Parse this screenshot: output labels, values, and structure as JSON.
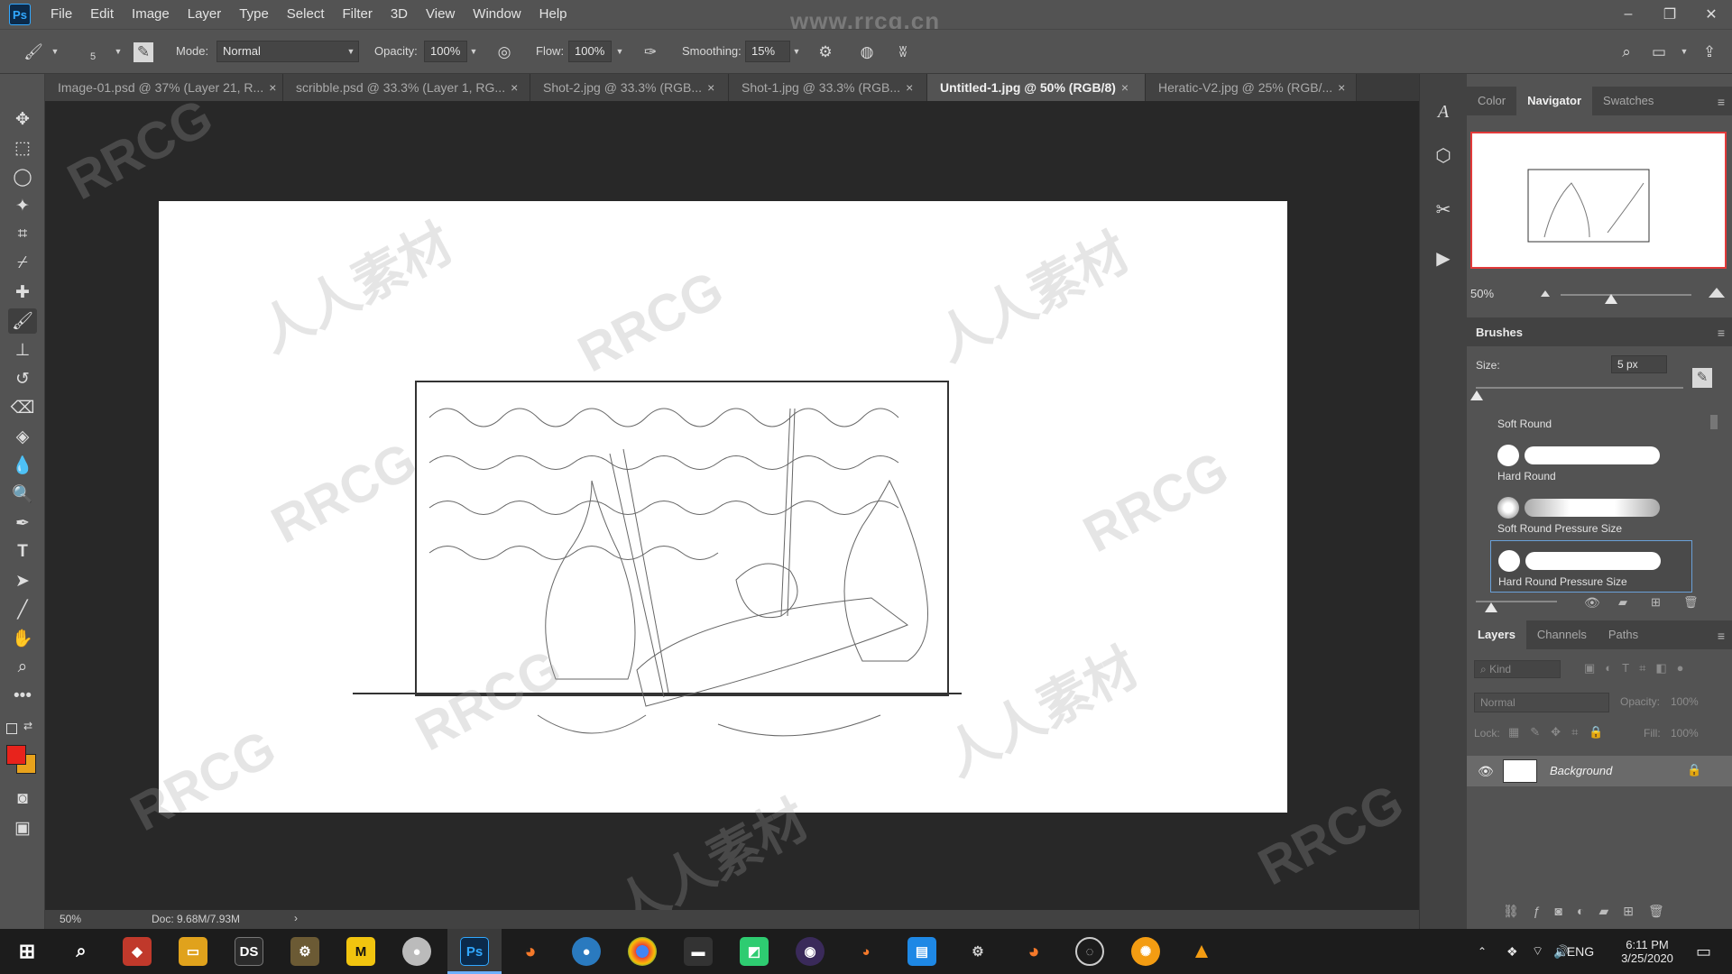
{
  "app": {
    "logo": "Ps",
    "menu": [
      "File",
      "Edit",
      "Image",
      "Layer",
      "Type",
      "Select",
      "Filter",
      "3D",
      "View",
      "Window",
      "Help"
    ],
    "watermark_top": "www.rrcg.cn"
  },
  "window_controls": {
    "minimize": "–",
    "restore": "❐",
    "close": "✕"
  },
  "options": {
    "brush_size": "5",
    "mode_label": "Mode:",
    "mode_value": "Normal",
    "opacity_label": "Opacity:",
    "opacity_value": "100%",
    "flow_label": "Flow:",
    "flow_value": "100%",
    "smoothing_label": "Smoothing:",
    "smoothing_value": "15%"
  },
  "tabs": [
    {
      "label": "Image-01.psd @ 37% (Layer 21, R...",
      "close": "×"
    },
    {
      "label": "scribble.psd @ 33.3% (Layer 1, RG...",
      "close": "×"
    },
    {
      "label": "Shot-2.jpg @ 33.3% (RGB...",
      "close": "×"
    },
    {
      "label": "Shot-1.jpg @ 33.3% (RGB...",
      "close": "×"
    },
    {
      "label": "Untitled-1.jpg @ 50% (RGB/8)",
      "close": "×"
    },
    {
      "label": "Heratic-V2.jpg @ 25% (RGB/...",
      "close": "×"
    }
  ],
  "canvas_watermarks": [
    "RRCG",
    "人人素材"
  ],
  "status": {
    "zoom": "50%",
    "doc": "Doc: 9.68M/7.93M",
    "arrow": "›"
  },
  "panels": {
    "top_tabs": [
      "Color",
      "Navigator",
      "Swatches"
    ],
    "navigator_zoom": "50%",
    "brushes_title": "Brushes",
    "size_label": "Size:",
    "size_value": "5 px",
    "brushes": [
      {
        "name": "Soft Round"
      },
      {
        "name": "Hard Round"
      },
      {
        "name": "Soft Round Pressure Size"
      },
      {
        "name": "Hard Round Pressure Size"
      }
    ],
    "layers_tabs": [
      "Layers",
      "Channels",
      "Paths"
    ],
    "kind_placeholder": "Kind",
    "blend_mode": "Normal",
    "opacity_label": "Opacity:",
    "opacity_value": "100%",
    "lock_label": "Lock:",
    "fill_label": "Fill:",
    "fill_value": "100%",
    "layer_name": "Background"
  },
  "taskbar": {
    "apps": [
      "DS",
      "M",
      "Ps"
    ],
    "tray_lang": "ENG",
    "time": "6:11 PM",
    "date": "3/25/2020"
  },
  "colors": {
    "foreground": "#e8231c",
    "background": "#e8a21c",
    "accent": "#31a8ff"
  }
}
